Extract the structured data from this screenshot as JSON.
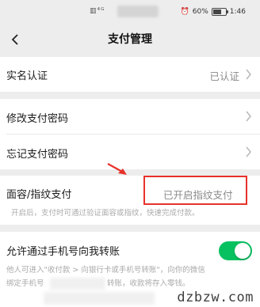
{
  "status_bar": {
    "left_icons": "▥⁴ᴳ",
    "battery": "60%",
    "time": "1:46"
  },
  "nav": {
    "title": "支付管理"
  },
  "rows": {
    "real_name": {
      "label": "实名认证",
      "value": "已认证"
    },
    "change_password": {
      "label": "修改支付密码"
    },
    "forgot_password": {
      "label": "忘记支付密码"
    },
    "face_fingerprint": {
      "label": "面容/指纹支付",
      "value": "已开启指纹支付",
      "description": "开启后，支付时可通过验证面容或指纹，快速完成付款。"
    },
    "phone_transfer": {
      "label": "允许通过手机号向我转账",
      "enabled": true,
      "description_line1": "他人可进入\"收付款 > 向银行卡或手机号转账\"，向你的微信",
      "description_line2_a": "绑定手机号",
      "description_line2_b": "转账，收款将存入零钱。"
    }
  },
  "colors": {
    "accent_green": "#07c160",
    "highlight_red": "#e8312b"
  },
  "watermark": "dzbzw.com"
}
